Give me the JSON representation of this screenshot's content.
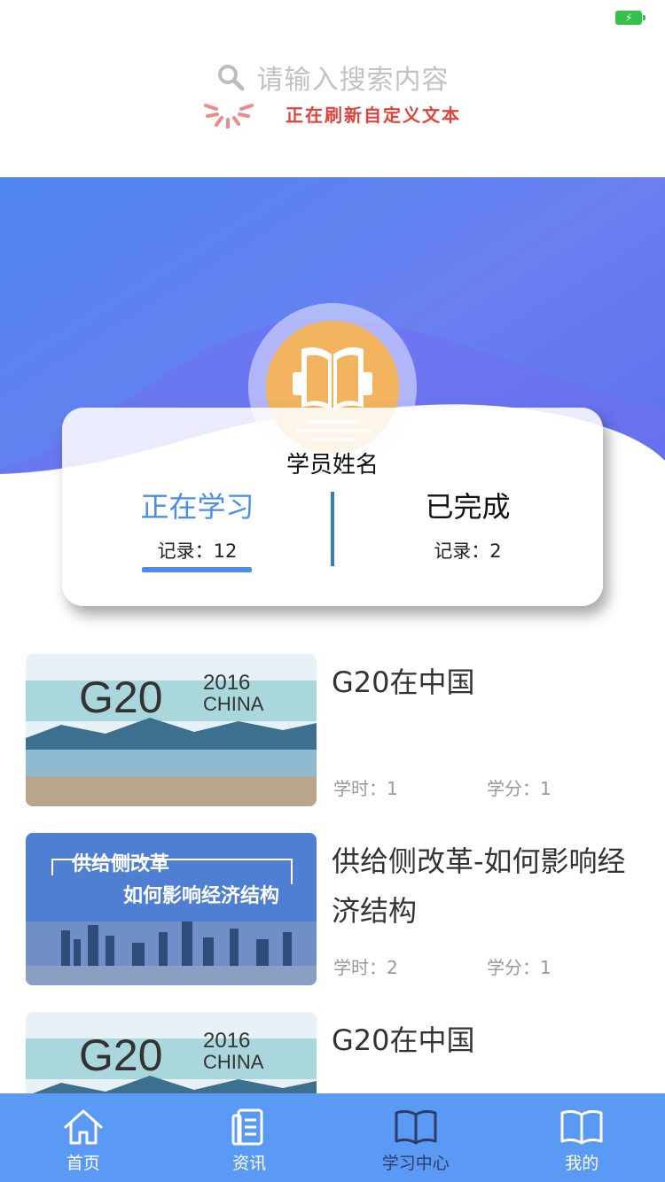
{
  "search": {
    "placeholder": "请输入搜索内容"
  },
  "refresh": {
    "text": "正在刷新自定义文本"
  },
  "profile": {
    "name": "学员姓名"
  },
  "tabs": [
    {
      "title": "正在学习",
      "record": "记录：12"
    },
    {
      "title": "已完成",
      "record": "记录：2"
    }
  ],
  "courses": [
    {
      "title": "G20在中国",
      "hours": "学时：1",
      "credit": "学分：1",
      "thumb_text": [
        "G20",
        "2016",
        "CHINA"
      ]
    },
    {
      "title": "供给侧改革-如何影响经济结构",
      "hours": "学时：2",
      "credit": "学分：1",
      "thumb_text": [
        "供给侧改革",
        "如何影响经济结构"
      ]
    },
    {
      "title": "G20在中国",
      "hours": "",
      "credit": "",
      "thumb_text": [
        "G20",
        "2016",
        "CHINA"
      ]
    }
  ],
  "tabbar": [
    {
      "label": "首页",
      "icon": "home-icon"
    },
    {
      "label": "资讯",
      "icon": "news-icon"
    },
    {
      "label": "学习中心",
      "icon": "book-icon",
      "active": true
    },
    {
      "label": "我的",
      "icon": "book-icon"
    }
  ],
  "colors": {
    "accent": "#4a8ee8",
    "tabbar": "#5a99f4",
    "refresh": "#e0433b",
    "battery": "#36c24a"
  }
}
